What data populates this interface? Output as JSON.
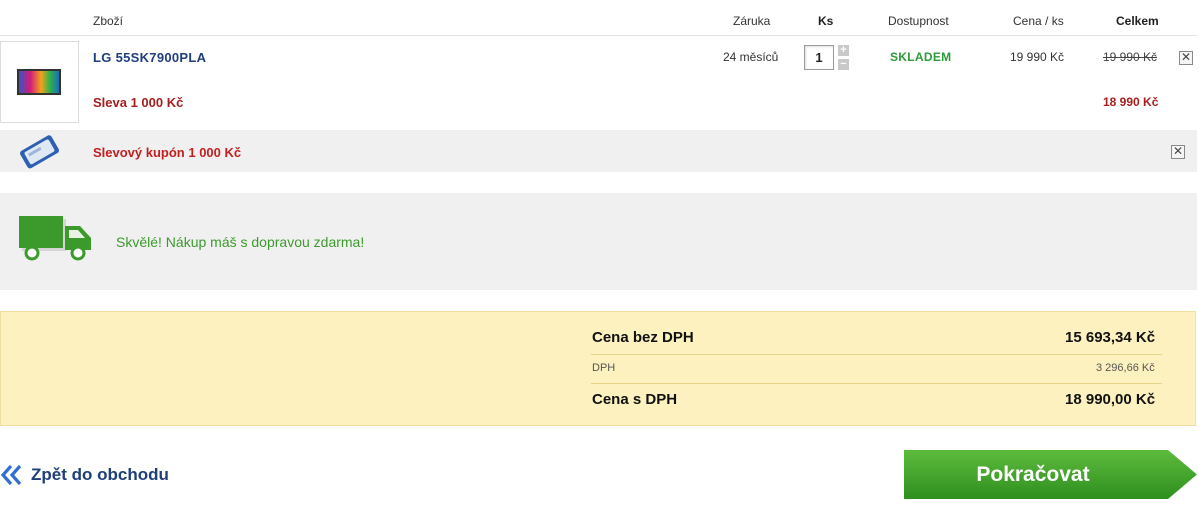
{
  "table_header": {
    "product": "Zboží",
    "warranty": "Záruka",
    "qty": "Ks",
    "availability": "Dostupnost",
    "unit_price": "Cena / ks",
    "total": "Celkem"
  },
  "item": {
    "name": "LG 55SK7900PLA",
    "warranty": "24 měsíců",
    "quantity": "1",
    "availability": "SKLADEM",
    "unit_price": "19 990 Kč",
    "total_original": "19 990 Kč",
    "discount_label": "Sleva 1 000 Kč",
    "total_discounted": "18 990 Kč"
  },
  "coupon": {
    "label": "Slevový kupón 1 000 Kč"
  },
  "shipping": {
    "message": "Skvělé! Nákup máš s dopravou zdarma!"
  },
  "summary": {
    "without_vat_label": "Cena bez DPH",
    "without_vat_value": "15 693,34 Kč",
    "vat_label": "DPH",
    "vat_value": "3 296,66 Kč",
    "with_vat_label": "Cena s DPH",
    "with_vat_value": "18 990,00 Kč"
  },
  "footer": {
    "back_label": "Zpět do obchodu",
    "continue_label": "Pokračovat"
  },
  "colors": {
    "brand_blue": "#1f3f7a",
    "stock_green": "#2d9a3a",
    "discount_red": "#a51e1e",
    "summary_bg": "#fdf1c0",
    "continue_green": "#3ea02a"
  }
}
